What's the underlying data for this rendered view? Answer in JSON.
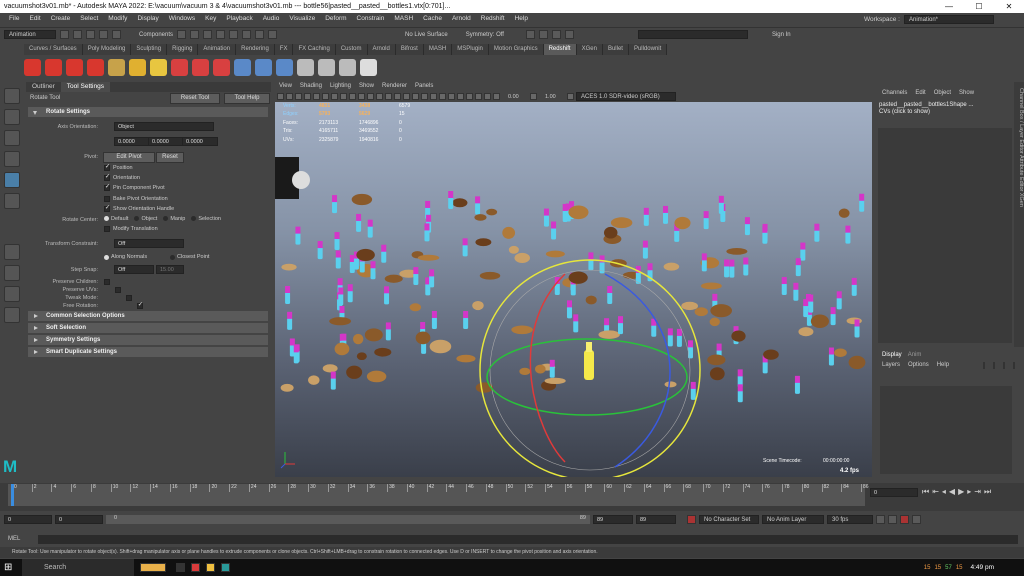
{
  "window": {
    "title": "vacuumshot3v01.mb* - Autodesk MAYA 2022: E:\\vacuum\\vacuum 3 & 4\\vacuumshot3v01.mb   ---   bottle56|pasted__pasted__bottles1.vtx[0:701]...",
    "min": "—",
    "max": "☐",
    "close": "✕"
  },
  "menubar": [
    "File",
    "Edit",
    "Create",
    "Select",
    "Modify",
    "Display",
    "Windows",
    "Key",
    "Playback",
    "Audio",
    "Visualize",
    "Deform",
    "Constrain",
    "MASH",
    "Cache",
    "Arnold",
    "Redshift",
    "Help"
  ],
  "workspace": {
    "label": "Workspace :",
    "value": "Animation*"
  },
  "status": {
    "mode": "Animation",
    "components": "Components",
    "live_surface": "No Live Surface",
    "symmetry": "Symmetry: Off",
    "sign_in": "Sign In"
  },
  "shelf_tabs": [
    "Curves / Surfaces",
    "Poly Modeling",
    "Sculpting",
    "Rigging",
    "Animation",
    "Rendering",
    "FX",
    "FX Caching",
    "Custom",
    "Arnold",
    "Bifrost",
    "MASH",
    "MSPlugin",
    "Motion Graphics",
    "Redshift",
    "XGen",
    "Bullet",
    "Pulldownit"
  ],
  "shelf_active": "Redshift",
  "left_tabs": [
    "Outliner",
    "Tool Settings"
  ],
  "tool": {
    "name": "Rotate Tool",
    "reset": "Reset Tool",
    "help": "Tool Help"
  },
  "rotate_settings": {
    "title": "Rotate Settings",
    "axis_label": "Axis Orientation:",
    "axis_value": "Object",
    "vals": [
      "0.0000",
      "0.0000",
      "0.0000"
    ],
    "pivot_label": "Pivot:",
    "edit_pivot": "Edit Pivot",
    "reset": "Reset",
    "pivot_opts": [
      "Position",
      "Orientation",
      "Pin Component Pivot",
      "Bake Pivot Orientation",
      "Show Orientation Handle",
      "Modify Translation"
    ],
    "rc_label": "Rotate Center:",
    "rc_opts": [
      "Default",
      "Object",
      "Manip",
      "Selection"
    ],
    "tc_label": "Transform Constraint:",
    "tc_value": "Off",
    "along": "Along Normals",
    "closest": "Closest Point",
    "step_label": "Step Snap:",
    "step_value": "Off",
    "step_num": "15.00",
    "preserve_children": "Preserve Children:",
    "preserve_uvs": "Preserve UVs:",
    "tweak": "Tweak Mode:",
    "free": "Free Rotation:"
  },
  "frames": [
    "Common Selection Options",
    "Soft Selection",
    "Symmetry Settings",
    "Smart Duplicate Settings"
  ],
  "vp_menu": [
    "View",
    "Shading",
    "Lighting",
    "Show",
    "Renderer",
    "Panels"
  ],
  "vp_values": {
    "a": "0.00",
    "b": "1.00",
    "cs": "ACES 1.0 SDR-video (sRGB)"
  },
  "hud": {
    "rows": [
      {
        "k": "Verts:",
        "a": "4831",
        "b": "3438",
        "c": "6579"
      },
      {
        "k": "Edges:",
        "a": "5793",
        "b": "5629",
        "c": "15"
      },
      {
        "k": "Faces:",
        "a": "2173113",
        "b": "1746896",
        "c": "0"
      },
      {
        "k": "Tris:",
        "a": "4165711",
        "b": "3469552",
        "c": "0"
      },
      {
        "k": "UVs:",
        "a": "2325879",
        "b": "1940816",
        "c": "0"
      }
    ],
    "timecode_label": "Scene Timecode:",
    "timecode": "00:00:00:00",
    "fps": "4.2 fps"
  },
  "channel_box": {
    "menus": [
      "Channels",
      "Edit",
      "Object",
      "Show"
    ],
    "name": "pasted__pasted__bottles1Shape ...",
    "cvs": "CVs (click to show)"
  },
  "side_tabs": "Channel Box / Layer Editor   Attribute Editor   XGen",
  "layers": {
    "tabs": [
      "Display",
      "Anim"
    ],
    "menus": [
      "Layers",
      "Options",
      "Help"
    ]
  },
  "timeline": {
    "ticks": [
      "0",
      "2",
      "4",
      "6",
      "8",
      "10",
      "12",
      "14",
      "16",
      "18",
      "20",
      "22",
      "24",
      "26",
      "28",
      "30",
      "32",
      "34",
      "36",
      "38",
      "40",
      "42",
      "44",
      "46",
      "48",
      "50",
      "52",
      "54",
      "56",
      "58",
      "60",
      "62",
      "64",
      "66",
      "68",
      "70",
      "72",
      "74",
      "76",
      "78",
      "80",
      "82",
      "84",
      "86"
    ],
    "current": "0"
  },
  "range": {
    "start": "0",
    "inner_start": "0",
    "slider_val": "0",
    "slider_end": "89",
    "end1": "89",
    "end2": "89",
    "char_set": "No Character Set",
    "anim_layer": "No Anim Layer",
    "fps": "30 fps"
  },
  "mel": "MEL",
  "help": "Rotate Tool: Use manipulator to rotate object(s). Shift+drag manipulator axis or plane handles to extrude components or clone objects. Ctrl+Shift+LMB+drag to constrain rotation to connected edges. Use D or INSERT to change the pivot position and axis orientation.",
  "taskbar": {
    "search": "Search",
    "time": "4:49 pm",
    "tray": [
      "15",
      "15",
      "57",
      "15"
    ]
  },
  "colors": {
    "accent": "#4a7fa8",
    "selected_pink": "#d436c8",
    "cyan": "#5ad0ee",
    "gizmo_yellow": "#e6e63c",
    "gizmo_red": "#e03a3a",
    "gizmo_green": "#29c23a",
    "gizmo_blue": "#3a5ae0"
  }
}
